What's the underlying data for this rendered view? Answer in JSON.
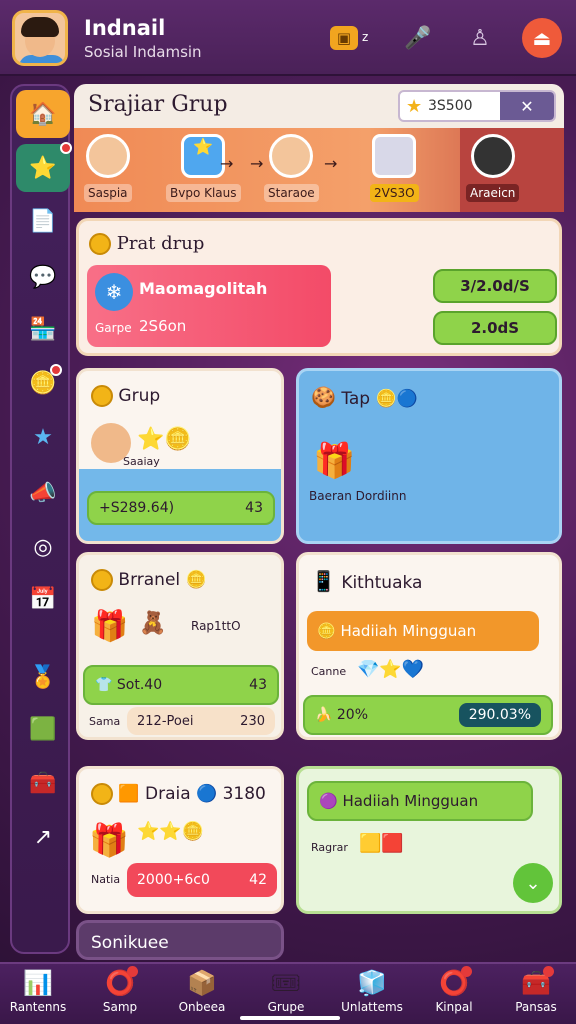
{
  "header": {
    "app_name": "Indnail",
    "subtitle": "Sosial Indamsin",
    "coin_badge": "z"
  },
  "sidebar": {
    "items": [
      {
        "icon": "home-icon"
      },
      {
        "icon": "star-icon"
      },
      {
        "icon": "document-icon"
      },
      {
        "icon": "chat-icon"
      },
      {
        "icon": "shop-icon"
      },
      {
        "icon": "coin-icon"
      },
      {
        "icon": "star-icon"
      },
      {
        "icon": "megaphone-icon"
      },
      {
        "icon": "search-icon"
      },
      {
        "icon": "calendar-icon"
      },
      {
        "icon": "badge-icon"
      },
      {
        "icon": "cube-icon"
      },
      {
        "icon": "chest-icon"
      },
      {
        "icon": "share-icon"
      }
    ]
  },
  "main": {
    "title": "Srajiar Grup",
    "search_value": "3S500",
    "banner": {
      "items": [
        "Saspia",
        "Bvpo Klaus",
        "Staraoe",
        "2VS3O",
        "Araeicn"
      ]
    },
    "panel_top": {
      "header": "Prat drup",
      "card_title": "Maomagolitah",
      "card_sub": "Garpe",
      "card_value": "2S6on",
      "pill1": "3/2.0d/S",
      "pill2": "2.0dS"
    },
    "grup_card": {
      "header": "Grup",
      "member": "Saaiay",
      "pill_value": "+S289.64)",
      "pill_right": "43"
    },
    "top_card": {
      "header": "Tap",
      "caption": "Baeran Dordiinn"
    },
    "brand_card": {
      "header": "Brranel",
      "side_label": "Rap1ttO",
      "pill_value": "Sot.40",
      "pill_right": "43",
      "row_label": "Sama",
      "row_value": "212-Poei",
      "row_right": "230"
    },
    "kith_card": {
      "header": "Kithtuaka",
      "banner_title": "Hadiiah Mingguan",
      "row_label": "Canne",
      "pill_left": "20%",
      "pill_right": "290.03%"
    },
    "draia_card": {
      "header": "Draia",
      "header_value": "3180",
      "row_label": "Natia",
      "pill_value": "2000+6c0",
      "pill_right": "42"
    },
    "hadiah_card": {
      "header": "Hadiiah Mingguan",
      "row_label": "Ragrar"
    },
    "partial_card": {
      "header": "Sonikuee"
    }
  },
  "bottom_nav": {
    "items": [
      "Rantenns",
      "Samp",
      "Onbeea",
      "Grupe",
      "Unlattems",
      "Kinpal",
      "Pansas"
    ]
  },
  "colors": {
    "accent": "#f7a52d",
    "brand_purple": "#4a2158",
    "green": "#8fd34a",
    "pink": "#f34b68",
    "blue": "#6fb4e8"
  }
}
